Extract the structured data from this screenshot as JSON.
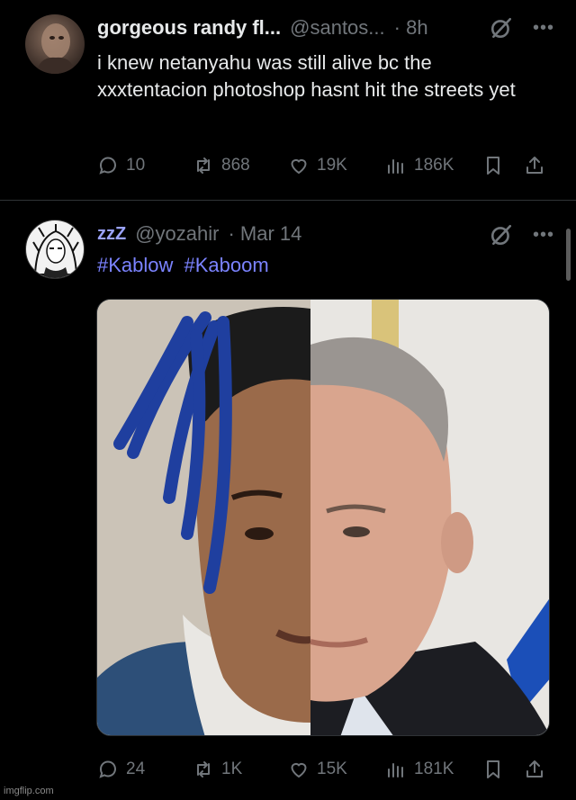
{
  "tweet1": {
    "display_name": "gorgeous randy fl...",
    "handle": "@santos...",
    "time": "· 8h",
    "text": "i knew netanyahu was still alive bc the xxxtentacion photoshop hasnt hit the streets yet",
    "replies": "10",
    "retweets": "868",
    "likes": "19K",
    "views": "186K"
  },
  "tweet2": {
    "zz": "zzZ",
    "handle": "@yozahir",
    "time": "· Mar 14",
    "hashtags": [
      "#Kablow",
      "#Kaboom"
    ],
    "replies": "24",
    "retweets": "1K",
    "likes": "15K",
    "views": "181K"
  },
  "icons": {
    "reply": "reply-icon",
    "retweet": "retweet-icon",
    "like": "heart-icon",
    "views": "views-bar-chart-icon",
    "bookmark": "bookmark-icon",
    "share": "share-icon",
    "grok": "grok-icon",
    "more": "more-icon"
  },
  "colors": {
    "background": "#000000",
    "text": "#e7e9ea",
    "muted": "#71767b",
    "hashtag": "#7b83ff"
  },
  "watermark": "imgflip.com"
}
